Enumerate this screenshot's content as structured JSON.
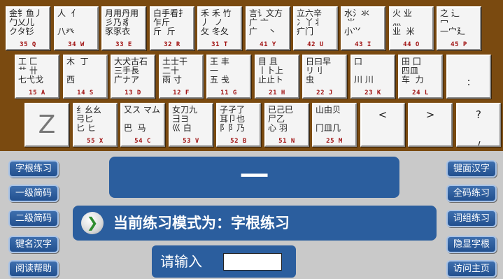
{
  "keyboard": {
    "row1": [
      {
        "roots": "金钅鱼丿\n勹乂儿 \nクタ钐",
        "code": "35 Q"
      },
      {
        "roots": "人  亻\n\n八癶",
        "code": "34 W"
      },
      {
        "roots": "月用丹用\n彡乃豸 \n豕豕衣",
        "code": "33 E"
      },
      {
        "roots": "白手看扌\n乍斤\n斤  斤",
        "code": "32 R"
      },
      {
        "roots": "禾 禾 竹\n丿  ノ\n攵 冬夂",
        "code": "31 T"
      },
      {
        "roots": "言讠文方\n广 亠\n广    丶",
        "code": "41 Y"
      },
      {
        "roots": "立六辛\n冫丫丬\n疒门",
        "code": "42 U"
      },
      {
        "roots": "水氵氺\n ⺌ \n小⺍",
        "code": "43 I"
      },
      {
        "roots": "火 业\n灬  \n业  米",
        "code": "44 O"
      },
      {
        "roots": "之 辶\n冖  \n一宀廴",
        "code": "45 P"
      }
    ],
    "row2": [
      {
        "roots": "工 匚\n艹 卄\n七弋戈",
        "code": "15 A"
      },
      {
        "roots": "木  丁\n\n西",
        "code": "14 S"
      },
      {
        "roots": "大犬古石\n三手長\n广ナア",
        "code": "13 D"
      },
      {
        "roots": "土士干\n二十\n雨 寸",
        "code": "12 F"
      },
      {
        "roots": "王 丰\n一\n五 戋",
        "code": "11 G"
      },
      {
        "roots": "目 且\n丨卜上\n止止ト",
        "code": "21 H"
      },
      {
        "roots": "日曰早\nリ刂\n虫",
        "code": "22 J"
      },
      {
        "roots": "口\n\n川 川",
        "code": "23 K"
      },
      {
        "roots": "田 囗\n四皿\n车  力",
        "code": "24 L"
      },
      {
        "roots": "\n:",
        "code": ""
      }
    ],
    "row3": [
      {
        "roots": "Z",
        "code": ""
      },
      {
        "roots": "纟幺幺\n弓匕\n匕 ヒ",
        "code": "55 X"
      },
      {
        "roots": "又ス マム\n\n巴  马",
        "code": "54 C"
      },
      {
        "roots": "女刀九\n彐ヨ\n巛 白",
        "code": "53 V"
      },
      {
        "roots": "子孑了\n耳卩也\n阝阝乃",
        "code": "52 B"
      },
      {
        "roots": "已己巳\n尸乙\n心 羽",
        "code": "51 N"
      },
      {
        "roots": "山由贝\n\n冂皿几",
        "code": "25 M"
      },
      {
        "roots": "<\n\n,",
        "code": ""
      },
      {
        "roots": ">\n\n。",
        "code": ""
      },
      {
        "roots": "?\n\n/",
        "code": ""
      }
    ]
  },
  "left_buttons": [
    "字根练习",
    "一级简码",
    "二级简码",
    "键名汉字",
    "阅读帮助"
  ],
  "right_buttons": [
    "键面汉字",
    "全码练习",
    "词组练习",
    "隐显字根",
    "访问主页"
  ],
  "display": {
    "current_char": "一"
  },
  "mode_bar": {
    "icon": "check-arrow-icon",
    "text": "当前练习模式为：字根练习"
  },
  "input": {
    "label": "请输入",
    "value": ""
  },
  "colors": {
    "keyboard_bg": "#7a4a10",
    "panel_blue": "#2b5e9e",
    "code_red": "#a01010",
    "page_bg": "#c9c9c9"
  }
}
